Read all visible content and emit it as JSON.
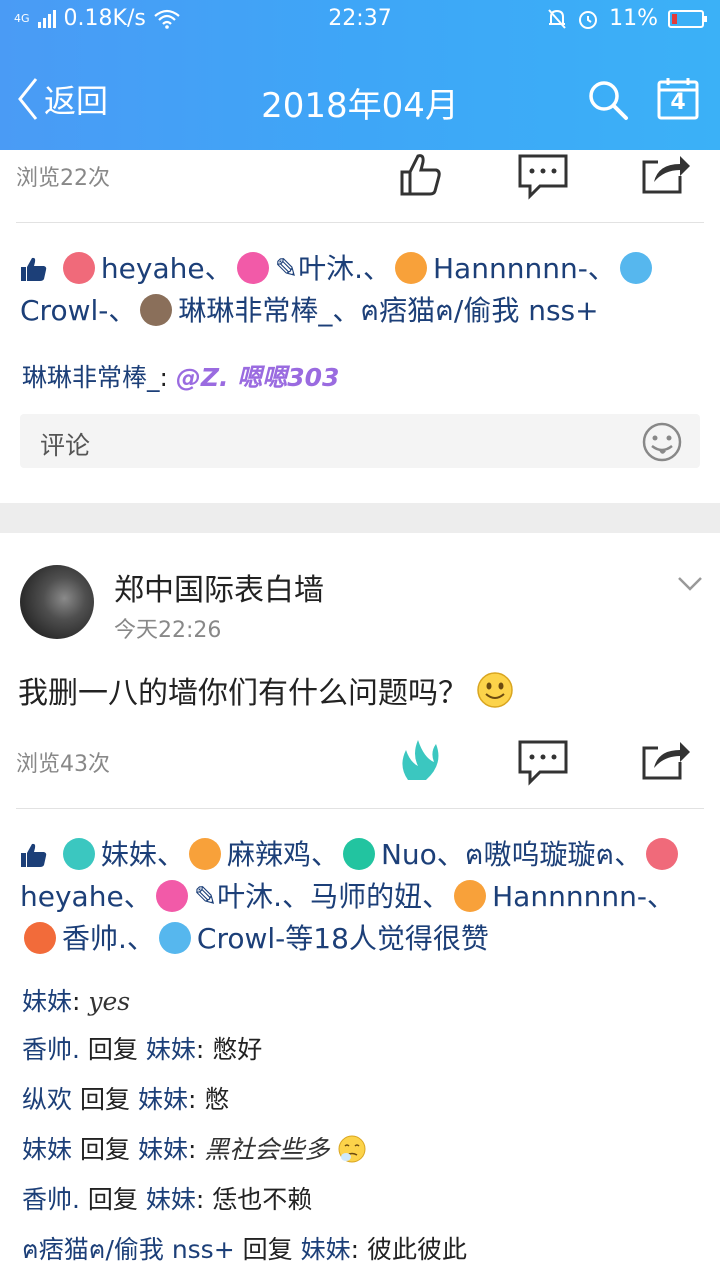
{
  "status_bar": {
    "network": "4G",
    "speed": "0.18K/s",
    "time": "22:37",
    "battery": "11%"
  },
  "navbar": {
    "back_label": "返回",
    "title": "2018年04月",
    "calendar_day": "4"
  },
  "post1": {
    "views": "浏览22次",
    "likes": [
      {
        "name": "heyahe",
        "sep": "、",
        "badge_color": "#f06a7a"
      },
      {
        "name": "✎叶沐.",
        "sep": "、",
        "badge_color": "#f25aa8"
      },
      {
        "name": "Hannnnnn-",
        "sep": "、",
        "badge_color": "#f8a13a"
      },
      {
        "name": "Crowl-",
        "sep": "、",
        "badge_color": "#56b7ee"
      },
      {
        "name": "琳琳非常棒_",
        "sep": "、",
        "badge_color": "#8a6f5a"
      },
      {
        "name": "ฅ痞猫ฅ/偷我 nss+",
        "sep": "",
        "badge_color": ""
      }
    ],
    "comment": {
      "author": "琳琳非常棒_",
      "colon": ": ",
      "text": "@Z. 嗯嗯303"
    },
    "comment_placeholder": "评论"
  },
  "post2": {
    "poster": "郑中国际表白墙",
    "time": "今天22:26",
    "text": "我删一八的墙你们有什么问题吗？",
    "views": "浏览43次",
    "likes": [
      {
        "name": "妹妹",
        "sep": "、",
        "badge_color": "#3bc7c0"
      },
      {
        "name": "麻辣鸡",
        "sep": "、",
        "badge_color": "#f8a13a"
      },
      {
        "name": "Nuo",
        "sep": "、",
        "badge_color": "#22c4a0"
      },
      {
        "name": "ฅ嗷呜璇璇ฅ",
        "sep": "、",
        "badge_color": ""
      },
      {
        "name": "heyahe",
        "sep": "、",
        "badge_color": "#f06a7a"
      },
      {
        "name": "✎叶沐.",
        "sep": "、",
        "badge_color": "#f25aa8"
      },
      {
        "name": "马师的妞",
        "sep": "、",
        "badge_color": ""
      },
      {
        "name": "Hannnnnn-",
        "sep": "、",
        "badge_color": "#f8a13a"
      },
      {
        "name": "香帅.",
        "sep": "、",
        "badge_color": "#f26b3a"
      },
      {
        "name": "Crowl-",
        "sep": "",
        "badge_color": "#56b7ee"
      }
    ],
    "likes_suffix": "等18人觉得很赞",
    "comments": [
      {
        "from": "妹妹",
        "reply": "",
        "to": "",
        "colon": ": ",
        "text": "yes"
      },
      {
        "from": "香帅.",
        "reply": "回复",
        "to": "妹妹",
        "colon": ": ",
        "text": "憋好"
      },
      {
        "from": "纵欢",
        "reply": "回复",
        "to": "妹妹",
        "colon": ": ",
        "text": "憋"
      },
      {
        "from": "妹妹",
        "reply": "回复",
        "to": "妹妹",
        "colon": ": ",
        "text": "黑社会些多"
      },
      {
        "from": "香帅.",
        "reply": "回复",
        "to": "妹妹",
        "colon": ": ",
        "text": "恁也不赖"
      },
      {
        "from": "ฅ痞猫ฅ/偷我 nss+",
        "reply": "回复",
        "to": "妹妹",
        "colon": ": ",
        "text": "彼此彼此"
      }
    ]
  },
  "colors": {
    "header_start": "#4a9bf5",
    "header_end": "#3bb1f7",
    "username": "#1c3f78",
    "muted": "#888888"
  }
}
